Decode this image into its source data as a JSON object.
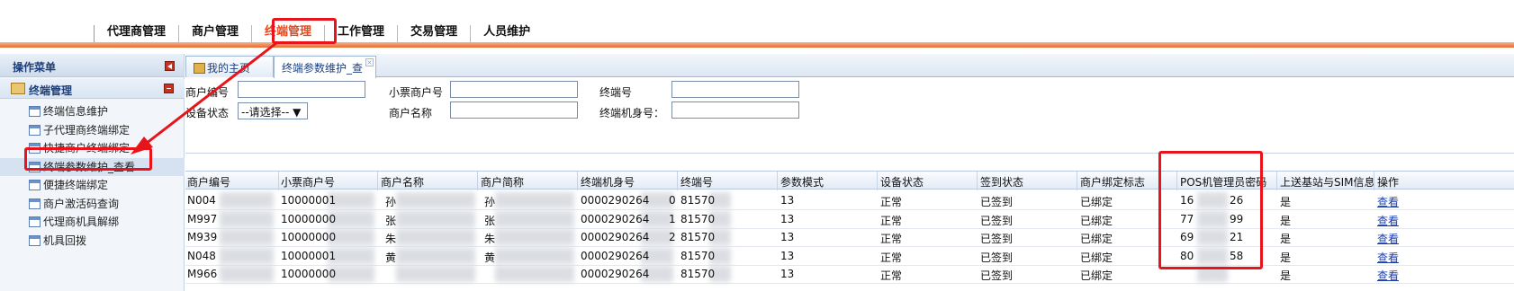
{
  "topnav": {
    "items": [
      "代理商管理",
      "商户管理",
      "终端管理",
      "工作管理",
      "交易管理",
      "人员维护"
    ]
  },
  "sidebar": {
    "title": "操作菜单",
    "group": "终端管理",
    "items": [
      {
        "label": "终端信息维护"
      },
      {
        "label": "子代理商终端绑定"
      },
      {
        "label": "快捷商户终端绑定"
      },
      {
        "label": "终端参数维护_查看"
      },
      {
        "label": "便捷终端绑定"
      },
      {
        "label": "商户激活码查询"
      },
      {
        "label": "代理商机具解绑"
      },
      {
        "label": "机具回拨"
      }
    ]
  },
  "tabs": {
    "home": "我的主页",
    "current": "终端参数维护_查"
  },
  "form": {
    "merchant_no": "商户编号",
    "ticket_merchant_no": "小票商户号",
    "terminal_no": "终端号",
    "device_status": "设备状态",
    "device_status_value": "--请选择-- ▼",
    "merchant_name": "商户名称",
    "terminal_sn": "终端机身号："
  },
  "grid": {
    "headers": [
      "商户编号",
      "小票商户号",
      "商户名称",
      "商户简称",
      "终端机身号",
      "终端号",
      "参数模式",
      "设备状态",
      "签到状态",
      "商户绑定标志",
      "POS机管理员密码",
      "上送基站与SIM信息",
      "操作"
    ],
    "rows": [
      [
        "N004",
        "10000001",
        "孙",
        "孙",
        "0000290264",
        "0",
        "81570",
        "13",
        "正常",
        "已签到",
        "已绑定",
        "16",
        "26",
        "是",
        "查看"
      ],
      [
        "M997",
        "10000000",
        "张",
        "张",
        "0000290264",
        "1",
        "81570",
        "13",
        "正常",
        "已签到",
        "已绑定",
        "77",
        "99",
        "是",
        "查看"
      ],
      [
        "M939",
        "10000000",
        "朱",
        "朱",
        "0000290264",
        "2",
        "81570",
        "13",
        "正常",
        "已签到",
        "已绑定",
        "69",
        "21",
        "是",
        "查看"
      ],
      [
        "N048",
        "10000001",
        "黄",
        "黄",
        "0000290264",
        "",
        "81570",
        "13",
        "正常",
        "已签到",
        "已绑定",
        "80",
        "58",
        "是",
        "查看"
      ],
      [
        "M966",
        "10000000",
        "",
        "",
        "0000290264",
        "",
        "81570",
        "13",
        "正常",
        "已签到",
        "已绑定",
        "",
        "",
        "是",
        "查看"
      ]
    ]
  }
}
